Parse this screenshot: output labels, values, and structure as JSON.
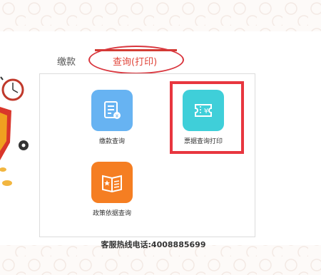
{
  "tabs": [
    {
      "label": "缴款"
    },
    {
      "label": "查询(打印)"
    }
  ],
  "tiles": [
    {
      "label": "缴款查询",
      "icon": "document-search-icon",
      "color": "#67b3f2"
    },
    {
      "label": "票据查询打印",
      "icon": "receipt-yuan-icon",
      "color": "#3fcfd9"
    },
    {
      "label": "政策依据查询",
      "icon": "policy-book-icon",
      "color": "#f57e22"
    }
  ],
  "hotline": "客服热线电话:4008885699",
  "colors": {
    "accent_red": "#e0453a",
    "highlight_red": "#e8363f"
  }
}
